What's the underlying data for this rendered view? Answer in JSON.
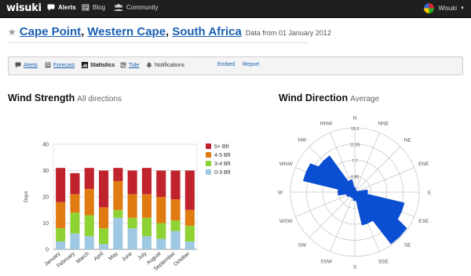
{
  "app": {
    "logo": "wisuki"
  },
  "nav": [
    {
      "label": "Alerts",
      "icon": "alert-icon"
    },
    {
      "label": "Blog",
      "icon": "blog-icon"
    },
    {
      "label": "Community",
      "icon": "community-icon"
    }
  ],
  "user": {
    "name": "Wisuki"
  },
  "location": {
    "point": "Cape Point",
    "region": "Western Cape",
    "country": "South Africa",
    "subtitle": "Data from 01 January 2012",
    "sep": ","
  },
  "tabs": [
    {
      "label": "Alerts",
      "icon": "alert-icon"
    },
    {
      "label": "Forecast",
      "icon": "forecast-icon"
    },
    {
      "label": "Statistics",
      "icon": "statistics-icon"
    },
    {
      "label": "Tide",
      "icon": "tide-icon"
    },
    {
      "label": "Notifications",
      "icon": "bell-icon"
    },
    {
      "label": "Embed"
    },
    {
      "label": "Report"
    }
  ],
  "wind_strength": {
    "title": "Wind Strength",
    "subtitle": "All directions"
  },
  "wind_direction": {
    "title": "Wind Direction",
    "subtitle": "Average"
  },
  "colors": {
    "bft5": "#c0232b",
    "bft4": "#e07b12",
    "bft3": "#8fd233",
    "bft0": "#9fc9e3",
    "rose": "#0a4fd1"
  },
  "chart_data": [
    {
      "type": "bar",
      "stacked": true,
      "categories": [
        "January",
        "February",
        "March",
        "April",
        "May",
        "June",
        "July",
        "August",
        "September",
        "October"
      ],
      "series": [
        {
          "name": "0-3 Bft",
          "values": [
            3,
            6,
            5,
            2,
            12,
            8,
            5,
            4,
            7,
            3
          ]
        },
        {
          "name": "3-4 Bft",
          "values": [
            5,
            8,
            8,
            6,
            3,
            4,
            7,
            6,
            4,
            6
          ]
        },
        {
          "name": "4-5 Bft",
          "values": [
            10,
            7,
            10,
            8,
            11,
            9,
            9,
            10,
            8,
            6
          ]
        },
        {
          "name": "5+ Bft",
          "values": [
            13,
            8,
            8,
            14,
            5,
            9,
            10,
            10,
            11,
            15
          ]
        }
      ],
      "ylabel": "Days",
      "ylim": [
        0,
        40
      ],
      "yticks": [
        0,
        10,
        20,
        30,
        40
      ],
      "legend": "right",
      "grid": true
    },
    {
      "type": "polar-area",
      "directions": [
        "N",
        "NNE",
        "NE",
        "ENE",
        "E",
        "ESE",
        "SE",
        "SSE",
        "S",
        "SSW",
        "SW",
        "WSW",
        "W",
        "WNW",
        "NW",
        "NNW"
      ],
      "values": [
        1.0,
        0.5,
        0.5,
        0.5,
        3.0,
        12.0,
        15.0,
        8.0,
        2.0,
        1.5,
        1.5,
        2.0,
        4.0,
        12.5,
        10.5,
        3.0
      ],
      "rtick_labels": [
        "3.85",
        "7.7",
        "11.55",
        "15.3"
      ],
      "rmax": 15.3
    }
  ]
}
